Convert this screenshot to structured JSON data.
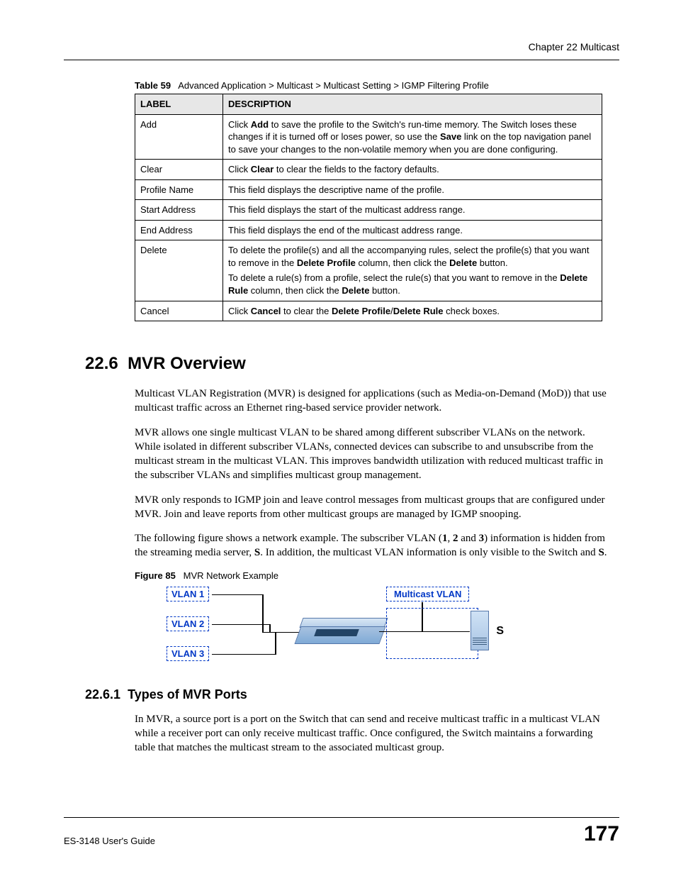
{
  "header": {
    "chapter": "Chapter 22 Multicast"
  },
  "table": {
    "caption_prefix": "Table 59",
    "caption": "Advanced Application > Multicast > Multicast Setting > IGMP Filtering Profile",
    "headers": {
      "label": "LABEL",
      "description": "DESCRIPTION"
    },
    "rows": [
      {
        "label": "Add",
        "desc_parts": [
          {
            "t": "Click ",
            "b": false
          },
          {
            "t": "Add",
            "b": true
          },
          {
            "t": " to save the profile to the Switch's run-time memory. The Switch loses these changes if it is turned off or loses power, so use the ",
            "b": false
          },
          {
            "t": "Save",
            "b": true
          },
          {
            "t": " link on the top navigation panel to save your changes to the non-volatile memory when you are done configuring.",
            "b": false
          }
        ]
      },
      {
        "label": "Clear",
        "desc_parts": [
          {
            "t": "Click ",
            "b": false
          },
          {
            "t": "Clear",
            "b": true
          },
          {
            "t": " to clear the fields to the factory defaults.",
            "b": false
          }
        ]
      },
      {
        "label": "Profile Name",
        "desc_parts": [
          {
            "t": "This field displays the descriptive name of the profile.",
            "b": false
          }
        ]
      },
      {
        "label": "Start Address",
        "desc_parts": [
          {
            "t": "This field displays the start of the multicast address range.",
            "b": false
          }
        ]
      },
      {
        "label": "End Address",
        "desc_parts": [
          {
            "t": "This field displays the end of the multicast address range.",
            "b": false
          }
        ]
      },
      {
        "label": "Delete",
        "desc_groups": [
          [
            {
              "t": "To delete the profile(s) and all the accompanying rules, select the profile(s) that you want to remove in the ",
              "b": false
            },
            {
              "t": "Delete Profile",
              "b": true
            },
            {
              "t": " column, then click the ",
              "b": false
            },
            {
              "t": "Delete",
              "b": true
            },
            {
              "t": " button.",
              "b": false
            }
          ],
          [
            {
              "t": "To delete a rule(s) from a profile, select the rule(s) that you want to remove in the ",
              "b": false
            },
            {
              "t": "Delete Rule",
              "b": true
            },
            {
              "t": " column, then click the ",
              "b": false
            },
            {
              "t": "Delete",
              "b": true
            },
            {
              "t": " button.",
              "b": false
            }
          ]
        ]
      },
      {
        "label": "Cancel",
        "desc_parts": [
          {
            "t": "Click ",
            "b": false
          },
          {
            "t": "Cancel",
            "b": true
          },
          {
            "t": " to clear the ",
            "b": false
          },
          {
            "t": "Delete Profile",
            "b": true
          },
          {
            "t": "/",
            "b": false
          },
          {
            "t": "Delete Rule",
            "b": true
          },
          {
            "t": " check boxes.",
            "b": false
          }
        ]
      }
    ]
  },
  "section": {
    "number": "22.6",
    "title": "MVR Overview",
    "paras": [
      "Multicast VLAN Registration (MVR) is designed for applications (such as Media-on-Demand (MoD)) that use multicast traffic across an Ethernet ring-based service provider network.",
      "MVR allows one single multicast VLAN to be shared among different subscriber VLANs on the network. While isolated in different subscriber VLANs, connected devices can subscribe to and unsubscribe from the multicast stream in the multicast VLAN. This improves bandwidth utilization with reduced multicast traffic in the subscriber VLANs and simplifies multicast group management.",
      "MVR only responds to IGMP join and leave control messages from multicast groups that are configured under MVR. Join and leave reports from other multicast groups are managed by IGMP snooping."
    ],
    "para4_parts": [
      {
        "t": "The following figure shows a network example. The subscriber VLAN (",
        "b": false
      },
      {
        "t": "1",
        "b": true
      },
      {
        "t": ", ",
        "b": false
      },
      {
        "t": "2",
        "b": true
      },
      {
        "t": " and ",
        "b": false
      },
      {
        "t": "3",
        "b": true
      },
      {
        "t": ") information is hidden from the streaming media server, ",
        "b": false
      },
      {
        "t": "S",
        "b": true
      },
      {
        "t": ". In addition, the multicast VLAN information is only visible to the Switch and ",
        "b": false
      },
      {
        "t": "S",
        "b": true
      },
      {
        "t": ".",
        "b": false
      }
    ]
  },
  "figure": {
    "caption_prefix": "Figure 85",
    "caption": "MVR Network Example",
    "labels": {
      "vlan1": "VLAN 1",
      "vlan2": "VLAN 2",
      "vlan3": "VLAN 3",
      "mvlan": "Multicast VLAN",
      "server": "S"
    }
  },
  "subsection": {
    "number": "22.6.1",
    "title": "Types of MVR Ports",
    "para": "In MVR, a source port is a port on the Switch that can send and receive multicast traffic in a multicast VLAN while a receiver port can only receive multicast traffic. Once configured, the Switch maintains a forwarding table that matches the multicast stream to the associated multicast group."
  },
  "footer": {
    "guide": "ES-3148 User's Guide",
    "page": "177"
  }
}
